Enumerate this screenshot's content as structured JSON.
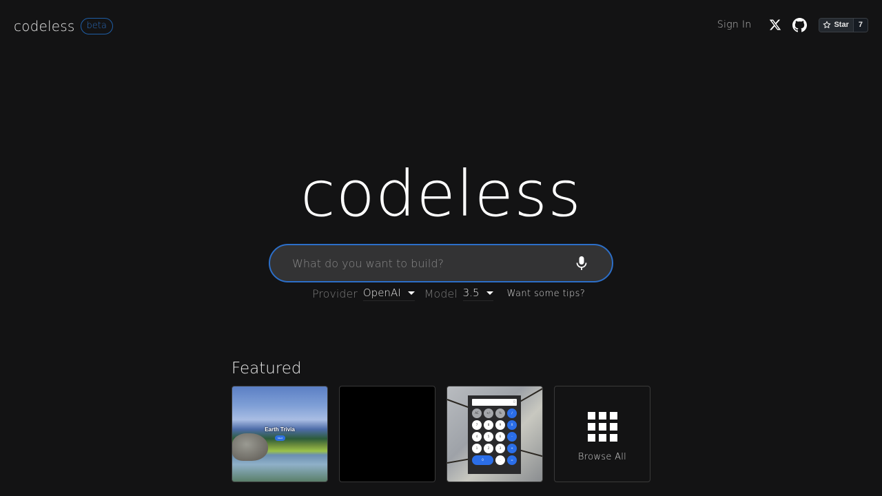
{
  "header": {
    "brand": "codeless",
    "badge": "beta",
    "sign_in": "Sign In",
    "icons": [
      "x-twitter-icon",
      "github-icon",
      "star-icon"
    ],
    "github_star": {
      "label": "Star",
      "count": "7"
    }
  },
  "hero": {
    "title": "codeless",
    "search_placeholder": "What do you want to build?",
    "search_value": "",
    "mic_icon": "microphone-icon"
  },
  "options": {
    "provider_label": "Provider",
    "provider_value": "OpenAI",
    "model_label": "Model",
    "model_value": "3.5",
    "tips_link": "Want some tips?"
  },
  "featured": {
    "title": "Featured",
    "cards": [
      {
        "name": "earth-trivia",
        "title": "Earth Trivia",
        "button": "Start"
      },
      {
        "name": "black-app"
      },
      {
        "name": "calculator",
        "display": "0",
        "keys": [
          "AC",
          "+/-",
          "%",
          "/",
          "7",
          "8",
          "9",
          "X",
          "4",
          "5",
          "6",
          "-",
          "1",
          "2",
          "3",
          "+",
          "0",
          ".",
          "="
        ]
      },
      {
        "name": "browse-all",
        "label": "Browse All"
      }
    ]
  },
  "colors": {
    "background": "#131314",
    "accent": "#2c6fc9",
    "search_bg": "#333334"
  }
}
